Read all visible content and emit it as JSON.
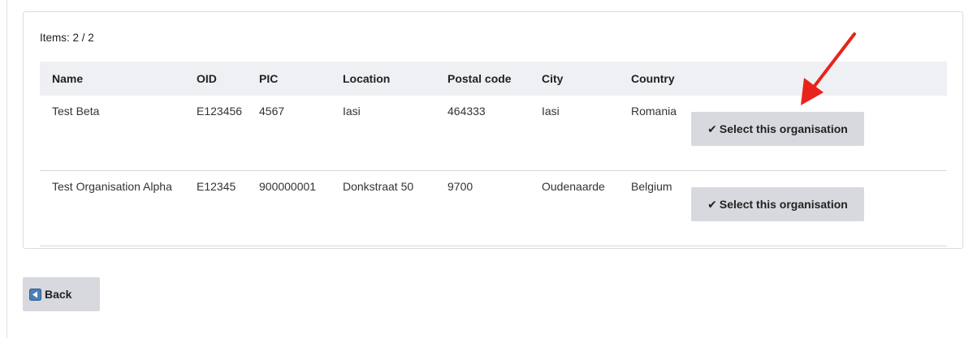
{
  "items_count": "Items: 2 / 2",
  "table": {
    "columns": [
      "Name",
      "OID",
      "PIC",
      "Location",
      "Postal code",
      "City",
      "Country",
      ""
    ],
    "rows": [
      {
        "name": "Test Beta",
        "oid": "E123456",
        "pic": "4567",
        "location": "Iasi",
        "postal_code": "464333",
        "city": "Iasi",
        "country": "Romania",
        "action_label": "Select this organisation"
      },
      {
        "name": "Test Organisation Alpha",
        "oid": "E12345",
        "pic": "900000001",
        "location": "Donkstraat 50",
        "postal_code": "9700",
        "city": "Oudenaarde",
        "country": "Belgium",
        "action_label": "Select this organisation"
      }
    ]
  },
  "check_glyph": "✔",
  "back_label": "Back",
  "icons": {
    "select": "check-icon",
    "back": "back-arrow-icon",
    "annotation": "red-arrow-icon"
  },
  "colors": {
    "button_bg": "#d8d9de",
    "header_bg": "#eff0f4",
    "back_icon": "#4a7fb5",
    "annotation": "#e8231b"
  }
}
